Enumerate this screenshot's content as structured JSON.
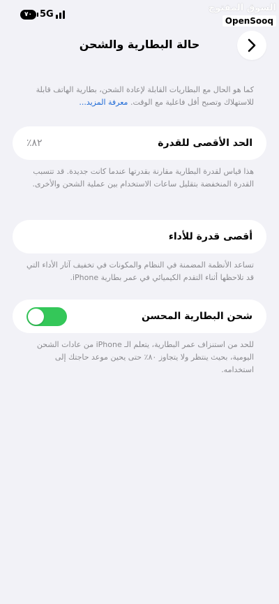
{
  "status_bar": {
    "battery": "٧٠",
    "network": "5G"
  },
  "watermark": {
    "arabic": "السوق المفتوح",
    "logo": "OpenSooq"
  },
  "header": {
    "title": "حالة البطارية والشحن",
    "back_icon": "chevron-right-icon"
  },
  "intro": {
    "text": "كما هو الحال مع البطاريات القابلة لإعادة الشحن، بطارية الهاتف قابلة للاستهلاك وتصبح أقل فاعلية مع الوقت.",
    "link": "معرفة المزيد..."
  },
  "max_capacity": {
    "label": "الحد الأقصى للقدرة",
    "value": "٨٢٪",
    "footnote": "هذا قياس لقدرة البطارية مقارنة بقدرتها عندما كانت جديدة. قد تتسبب القدرة المنخفضة بتقليل ساعات الاستخدام بين عملية الشحن والأخرى."
  },
  "peak_performance": {
    "label": "أقصى قدرة للأداء",
    "footnote": "تساعد الأنظمة المضمنة في النظام والمكونات في تخفيف آثار الأداء التي قد تلاحظها أثناء التقدم الكيميائي في عمر بطارية iPhone."
  },
  "optimized_charging": {
    "label": "شحن البطارية المحسن",
    "enabled": true,
    "toggle_color": "#34c759",
    "footnote": "للحد من استنزاف عمر البطارية، يتعلم الـ iPhone من عادات الشحن اليومية، بحيث ينتظر ولا يتجاوز ٨٠٪ حتى يحين موعد حاجتك إلى استخدامه."
  }
}
